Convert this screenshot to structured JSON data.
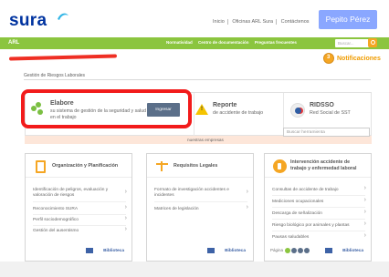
{
  "logo": "sura",
  "toplinks": [
    "Inicio",
    "Oficinas ARL Sura",
    "Contáctenos"
  ],
  "user_button": "Pepito Pérez",
  "greenbar": {
    "arl": "ARL",
    "links": [
      "Normatividad",
      "Centro de documentación",
      "Preguntas frecuentes"
    ],
    "search_placeholder": "Buscar..."
  },
  "notifications": "Notificaciones",
  "section_title": "Gestión de Riesgos Laborales",
  "cards": {
    "elabore": {
      "title": "Elabore",
      "text": "su sistema de gestión de la seguridad y salud en el trabajo",
      "button": "Ingresar"
    },
    "reporte": {
      "title": "Reporte",
      "text": "de accidente de trabajo"
    },
    "ridsso": {
      "title": "RIDSSO",
      "text": "Red Social de SST"
    }
  },
  "strip": {
    "text": "nuestras empresas",
    "search_placeholder": "Buscar herramienta"
  },
  "boxes": [
    {
      "title": "Organización y Planificación",
      "items": [
        "Identificación de peligros, evaluación y valoración de riesgos",
        "Reconocimiento SURA",
        "Perfil sociodemográfico",
        "Gestión del ausentismo"
      ],
      "footer": "Biblioteca"
    },
    {
      "title": "Requisitos Legales",
      "items": [
        "Formato de investigación accidentes e incidentes",
        "Matrices de legislación"
      ],
      "footer": "Biblioteca"
    },
    {
      "title": "Intervención accidente de trabajo y enfermedad laboral",
      "items": [
        "Consultas de accidente de trabajo",
        "Mediciones ocupacionales",
        "Descarga de señalización",
        "Riesgo biológico por animales y plantas",
        "Pausas saludables"
      ],
      "footer": "Biblioteca",
      "pager": "Página"
    }
  ]
}
